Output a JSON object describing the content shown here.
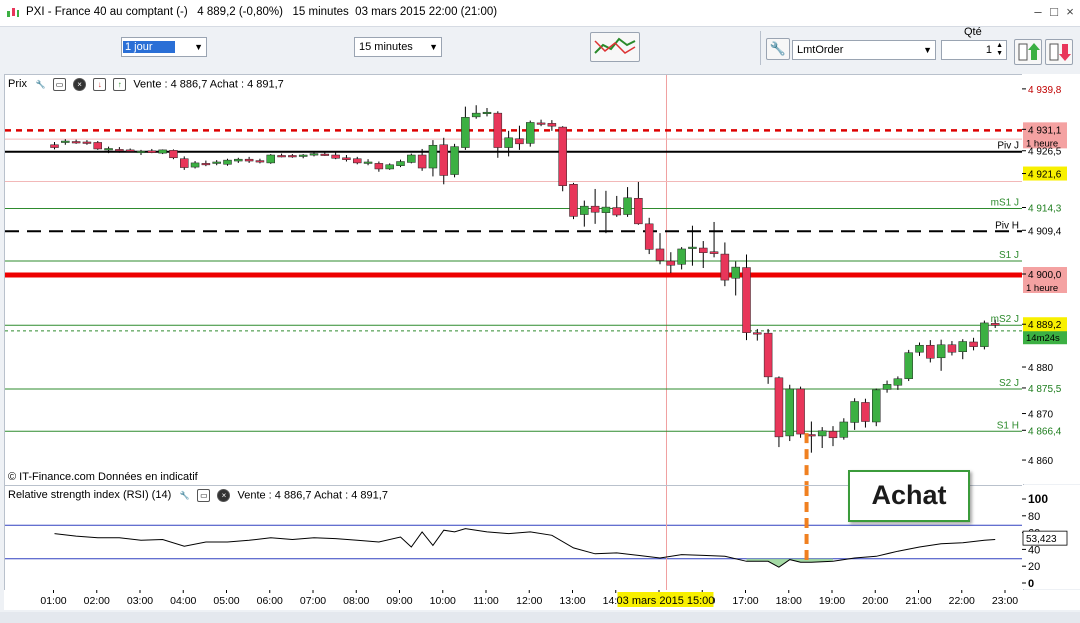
{
  "window": {
    "title": "PXI - France 40 au comptant (-)   4 889,2 (-0,80%)   15 minutes  03 mars 2015 22:00 (21:00)"
  },
  "toolbar": {
    "period_value": "1 jour",
    "interval_value": "15 minutes",
    "order_type_value": "LmtOrder",
    "qty_label": "Qté",
    "qty_value": "1"
  },
  "price_panel": {
    "label": "Prix",
    "quote": "Vente : 4 886,7 Achat : 4 891,7",
    "source": "© IT-Finance.com  Données en indicatif"
  },
  "rsi_panel": {
    "label": "Relative strength index (RSI) (14)",
    "quote": "Vente : 4 886,7 Achat : 4 891,7",
    "last_value": "53,423"
  },
  "annotation": {
    "label": "Achat"
  },
  "level_labels": [
    {
      "text": "Piv J",
      "value": 4926.5
    },
    {
      "text": "mS1 J",
      "value": 4914.3
    },
    {
      "text": "Piv H",
      "value": 4909.4
    },
    {
      "text": "S1 J",
      "value": 4903.0
    },
    {
      "text": "mS2 J",
      "value": 4889.2
    },
    {
      "text": "S2 J",
      "value": 4875.5
    },
    {
      "text": "S1 H",
      "value": 4866.4
    }
  ],
  "price_tags": [
    {
      "text": "4 939,8",
      "value": 4939.8,
      "style": "red-text"
    },
    {
      "text": "4 931,1",
      "sub": "1 heure",
      "value": 4931.1,
      "style": "red-box"
    },
    {
      "text": "4 926,5",
      "value": 4926.5,
      "style": "plain"
    },
    {
      "text": "4 921,6",
      "value": 4921.6,
      "style": "yellow-box"
    },
    {
      "text": "4 914,3",
      "value": 4914.3,
      "style": "green-text"
    },
    {
      "text": "4 909,4",
      "value": 4909.4,
      "style": "plain"
    },
    {
      "text": "4 900,0",
      "sub": "1 heure",
      "value": 4900.0,
      "style": "red-box"
    },
    {
      "text": "4 889,2",
      "sub": "14m24s",
      "value": 4889.2,
      "style": "yellow-green-box"
    },
    {
      "text": "4 880",
      "value": 4880,
      "style": "tick"
    },
    {
      "text": "4 875,5",
      "value": 4875.5,
      "style": "green-text"
    },
    {
      "text": "4 870",
      "value": 4870,
      "style": "tick"
    },
    {
      "text": "4 866,4",
      "value": 4866.4,
      "style": "green-text"
    },
    {
      "text": "4 860",
      "value": 4860,
      "style": "tick"
    }
  ],
  "rsi_ticks": [
    "100",
    "80",
    "60",
    "40",
    "20",
    "0"
  ],
  "time_ticks": [
    "01:00",
    "02:00",
    "03:00",
    "04:00",
    "05:00",
    "06:00",
    "07:00",
    "08:00",
    "09:00",
    "10:00",
    "11:00",
    "12:00",
    "13:00",
    "14:00",
    "15:00",
    "16:00",
    "17:00",
    "18:00",
    "19:00",
    "20:00",
    "21:00",
    "22:00",
    "23:00"
  ],
  "cursor_label": "03 mars 2015 15:00",
  "chart_data": {
    "type": "candlestick",
    "title": "PXI - France 40 au comptant (-)",
    "interval": "15 minutes",
    "ylim": [
      4857,
      4943
    ],
    "horizontal_lines": [
      {
        "value": 4931.1,
        "color": "#dd0000",
        "style": "dashed"
      },
      {
        "value": 4926.5,
        "color": "#000000",
        "style": "solid"
      },
      {
        "value": 4914.3,
        "color": "#2e8b2e",
        "style": "solid"
      },
      {
        "value": 4909.4,
        "color": "#000000",
        "style": "dashed"
      },
      {
        "value": 4903.0,
        "color": "#2e8b2e",
        "style": "solid"
      },
      {
        "value": 4900.0,
        "color": "#ee0000",
        "style": "thick"
      },
      {
        "value": 4889.2,
        "color": "#2e8b2e",
        "style": "solid"
      },
      {
        "value": 4875.5,
        "color": "#2e8b2e",
        "style": "solid"
      },
      {
        "value": 4866.4,
        "color": "#2e8b2e",
        "style": "solid"
      }
    ],
    "colors": {
      "up": "#3cb043",
      "down": "#e8365a",
      "wick": "#000000"
    },
    "candles": [
      {
        "t": 0.0,
        "o": 4928.0,
        "h": 4928.6,
        "l": 4927.0,
        "c": 4927.4
      },
      {
        "t": 0.25,
        "o": 4928.5,
        "h": 4929.2,
        "l": 4928.0,
        "c": 4928.8
      },
      {
        "t": 0.5,
        "o": 4928.7,
        "h": 4929.1,
        "l": 4928.2,
        "c": 4928.5
      },
      {
        "t": 0.75,
        "o": 4928.6,
        "h": 4929.0,
        "l": 4928.0,
        "c": 4928.3
      },
      {
        "t": 1.0,
        "o": 4928.5,
        "h": 4928.8,
        "l": 4926.9,
        "c": 4927.1
      },
      {
        "t": 1.25,
        "o": 4927.0,
        "h": 4927.6,
        "l": 4926.2,
        "c": 4927.2
      },
      {
        "t": 1.5,
        "o": 4927.0,
        "h": 4927.5,
        "l": 4926.3,
        "c": 4926.9
      },
      {
        "t": 1.75,
        "o": 4926.9,
        "h": 4927.2,
        "l": 4926.4,
        "c": 4926.6
      },
      {
        "t": 2.0,
        "o": 4926.5,
        "h": 4926.9,
        "l": 4925.8,
        "c": 4926.6
      },
      {
        "t": 2.25,
        "o": 4926.7,
        "h": 4927.1,
        "l": 4926.2,
        "c": 4926.3
      },
      {
        "t": 2.5,
        "o": 4926.2,
        "h": 4927.0,
        "l": 4926.0,
        "c": 4926.9
      },
      {
        "t": 2.75,
        "o": 4926.8,
        "h": 4927.0,
        "l": 4924.9,
        "c": 4925.2
      },
      {
        "t": 3.0,
        "o": 4925.0,
        "h": 4925.5,
        "l": 4922.6,
        "c": 4923.1
      },
      {
        "t": 3.25,
        "o": 4923.2,
        "h": 4924.5,
        "l": 4922.9,
        "c": 4924.1
      },
      {
        "t": 3.5,
        "o": 4924.0,
        "h": 4924.6,
        "l": 4923.4,
        "c": 4923.9
      },
      {
        "t": 3.75,
        "o": 4924.0,
        "h": 4924.7,
        "l": 4923.6,
        "c": 4924.3
      },
      {
        "t": 4.0,
        "o": 4923.8,
        "h": 4925.0,
        "l": 4923.5,
        "c": 4924.7
      },
      {
        "t": 4.25,
        "o": 4924.5,
        "h": 4925.2,
        "l": 4924.1,
        "c": 4924.9
      },
      {
        "t": 4.5,
        "o": 4924.9,
        "h": 4925.4,
        "l": 4924.1,
        "c": 4924.5
      },
      {
        "t": 4.75,
        "o": 4924.6,
        "h": 4925.0,
        "l": 4924.0,
        "c": 4924.4
      },
      {
        "t": 5.0,
        "o": 4924.1,
        "h": 4926.0,
        "l": 4923.9,
        "c": 4925.8
      },
      {
        "t": 5.25,
        "o": 4925.7,
        "h": 4926.1,
        "l": 4925.3,
        "c": 4925.6
      },
      {
        "t": 5.5,
        "o": 4925.7,
        "h": 4926.0,
        "l": 4925.2,
        "c": 4925.5
      },
      {
        "t": 5.75,
        "o": 4925.5,
        "h": 4926.0,
        "l": 4925.1,
        "c": 4925.8
      },
      {
        "t": 6.0,
        "o": 4925.8,
        "h": 4926.4,
        "l": 4925.5,
        "c": 4926.1
      },
      {
        "t": 6.25,
        "o": 4926.0,
        "h": 4926.4,
        "l": 4925.6,
        "c": 4925.8
      },
      {
        "t": 6.5,
        "o": 4925.8,
        "h": 4926.5,
        "l": 4924.9,
        "c": 4925.1
      },
      {
        "t": 6.75,
        "o": 4925.2,
        "h": 4925.8,
        "l": 4924.4,
        "c": 4924.8
      },
      {
        "t": 7.0,
        "o": 4925.0,
        "h": 4925.4,
        "l": 4923.8,
        "c": 4924.1
      },
      {
        "t": 7.25,
        "o": 4924.2,
        "h": 4924.9,
        "l": 4923.6,
        "c": 4924.3
      },
      {
        "t": 7.5,
        "o": 4924.0,
        "h": 4924.4,
        "l": 4922.2,
        "c": 4922.8
      },
      {
        "t": 7.75,
        "o": 4922.8,
        "h": 4924.0,
        "l": 4922.6,
        "c": 4923.7
      },
      {
        "t": 8.0,
        "o": 4923.5,
        "h": 4924.8,
        "l": 4923.2,
        "c": 4924.4
      },
      {
        "t": 8.25,
        "o": 4924.2,
        "h": 4926.1,
        "l": 4924.0,
        "c": 4925.8
      },
      {
        "t": 8.5,
        "o": 4925.8,
        "h": 4927.1,
        "l": 4922.4,
        "c": 4923.0
      },
      {
        "t": 8.75,
        "o": 4923.0,
        "h": 4929.0,
        "l": 4921.2,
        "c": 4927.9
      },
      {
        "t": 9.0,
        "o": 4928.0,
        "h": 4929.5,
        "l": 4919.5,
        "c": 4921.4
      },
      {
        "t": 9.25,
        "o": 4921.6,
        "h": 4928.2,
        "l": 4921.0,
        "c": 4927.6
      },
      {
        "t": 9.5,
        "o": 4927.4,
        "h": 4936.2,
        "l": 4926.9,
        "c": 4933.9
      },
      {
        "t": 9.75,
        "o": 4934.0,
        "h": 4936.5,
        "l": 4933.6,
        "c": 4934.8
      },
      {
        "t": 10.0,
        "o": 4934.8,
        "h": 4935.9,
        "l": 4934.1,
        "c": 4935.0
      },
      {
        "t": 10.25,
        "o": 4934.8,
        "h": 4935.2,
        "l": 4925.2,
        "c": 4927.4
      },
      {
        "t": 10.5,
        "o": 4927.4,
        "h": 4931.0,
        "l": 4925.5,
        "c": 4929.5
      },
      {
        "t": 10.75,
        "o": 4929.3,
        "h": 4932.1,
        "l": 4926.9,
        "c": 4928.2
      },
      {
        "t": 11.0,
        "o": 4928.3,
        "h": 4933.2,
        "l": 4927.6,
        "c": 4932.8
      },
      {
        "t": 11.25,
        "o": 4932.7,
        "h": 4933.4,
        "l": 4932.0,
        "c": 4932.6
      },
      {
        "t": 11.5,
        "o": 4932.6,
        "h": 4933.3,
        "l": 4931.0,
        "c": 4932.0
      },
      {
        "t": 11.75,
        "o": 4931.8,
        "h": 4932.0,
        "l": 4918.0,
        "c": 4919.2
      },
      {
        "t": 12.0,
        "o": 4919.5,
        "h": 4919.8,
        "l": 4912.0,
        "c": 4912.6
      },
      {
        "t": 12.25,
        "o": 4913.0,
        "h": 4916.0,
        "l": 4910.4,
        "c": 4914.8
      },
      {
        "t": 12.5,
        "o": 4914.8,
        "h": 4918.5,
        "l": 4911.0,
        "c": 4913.5
      },
      {
        "t": 12.75,
        "o": 4913.4,
        "h": 4918.1,
        "l": 4909.0,
        "c": 4914.6
      },
      {
        "t": 13.0,
        "o": 4914.5,
        "h": 4917.0,
        "l": 4912.5,
        "c": 4912.9
      },
      {
        "t": 13.25,
        "o": 4913.0,
        "h": 4918.9,
        "l": 4912.5,
        "c": 4916.6
      },
      {
        "t": 13.5,
        "o": 4916.5,
        "h": 4920.0,
        "l": 4910.8,
        "c": 4911.0
      },
      {
        "t": 13.75,
        "o": 4911.0,
        "h": 4912.3,
        "l": 4904.5,
        "c": 4905.5
      },
      {
        "t": 14.0,
        "o": 4905.6,
        "h": 4909.0,
        "l": 4902.3,
        "c": 4903.1
      },
      {
        "t": 14.25,
        "o": 4903.0,
        "h": 4904.9,
        "l": 4900.4,
        "c": 4902.1
      },
      {
        "t": 14.5,
        "o": 4902.3,
        "h": 4906.0,
        "l": 4901.2,
        "c": 4905.6
      },
      {
        "t": 14.75,
        "o": 4905.7,
        "h": 4910.6,
        "l": 4902.0,
        "c": 4906.0
      },
      {
        "t": 15.0,
        "o": 4905.8,
        "h": 4907.3,
        "l": 4901.5,
        "c": 4904.8
      },
      {
        "t": 15.25,
        "o": 4905.0,
        "h": 4911.4,
        "l": 4903.8,
        "c": 4904.6
      },
      {
        "t": 15.5,
        "o": 4904.5,
        "h": 4907.0,
        "l": 4897.6,
        "c": 4898.9
      },
      {
        "t": 15.75,
        "o": 4899.3,
        "h": 4902.9,
        "l": 4895.6,
        "c": 4901.7
      },
      {
        "t": 16.0,
        "o": 4901.6,
        "h": 4904.4,
        "l": 4886.0,
        "c": 4887.6
      },
      {
        "t": 16.25,
        "o": 4887.6,
        "h": 4888.4,
        "l": 4885.9,
        "c": 4887.3
      },
      {
        "t": 16.5,
        "o": 4887.5,
        "h": 4888.4,
        "l": 4876.6,
        "c": 4878.1
      },
      {
        "t": 16.75,
        "o": 4877.9,
        "h": 4878.2,
        "l": 4863.0,
        "c": 4865.2
      },
      {
        "t": 17.0,
        "o": 4865.4,
        "h": 4876.4,
        "l": 4864.3,
        "c": 4875.5
      },
      {
        "t": 17.25,
        "o": 4875.5,
        "h": 4876.0,
        "l": 4865.0,
        "c": 4865.8
      },
      {
        "t": 17.5,
        "o": 4865.7,
        "h": 4868.5,
        "l": 4861.8,
        "c": 4865.6
      },
      {
        "t": 17.75,
        "o": 4865.4,
        "h": 4867.3,
        "l": 4862.8,
        "c": 4866.5
      },
      {
        "t": 18.0,
        "o": 4866.4,
        "h": 4867.5,
        "l": 4863.2,
        "c": 4865.0
      },
      {
        "t": 18.25,
        "o": 4865.1,
        "h": 4869.2,
        "l": 4864.6,
        "c": 4868.4
      },
      {
        "t": 18.5,
        "o": 4868.3,
        "h": 4873.5,
        "l": 4866.7,
        "c": 4872.8
      },
      {
        "t": 18.75,
        "o": 4872.6,
        "h": 4873.4,
        "l": 4867.2,
        "c": 4868.5
      },
      {
        "t": 19.0,
        "o": 4868.4,
        "h": 4875.6,
        "l": 4867.5,
        "c": 4875.3
      },
      {
        "t": 19.25,
        "o": 4875.4,
        "h": 4877.3,
        "l": 4874.7,
        "c": 4876.5
      },
      {
        "t": 19.5,
        "o": 4876.3,
        "h": 4878.2,
        "l": 4875.3,
        "c": 4877.7
      },
      {
        "t": 19.75,
        "o": 4877.7,
        "h": 4883.9,
        "l": 4877.2,
        "c": 4883.3
      },
      {
        "t": 20.0,
        "o": 4883.4,
        "h": 4885.5,
        "l": 4882.6,
        "c": 4884.9
      },
      {
        "t": 20.25,
        "o": 4884.9,
        "h": 4886.0,
        "l": 4881.2,
        "c": 4882.1
      },
      {
        "t": 20.5,
        "o": 4882.2,
        "h": 4886.1,
        "l": 4879.4,
        "c": 4885.0
      },
      {
        "t": 20.75,
        "o": 4885.0,
        "h": 4885.8,
        "l": 4882.7,
        "c": 4883.4
      },
      {
        "t": 21.0,
        "o": 4883.5,
        "h": 4886.2,
        "l": 4881.9,
        "c": 4885.7
      },
      {
        "t": 21.25,
        "o": 4885.6,
        "h": 4886.5,
        "l": 4883.8,
        "c": 4884.6
      },
      {
        "t": 21.5,
        "o": 4884.6,
        "h": 4890.2,
        "l": 4884.0,
        "c": 4889.7
      },
      {
        "t": 21.75,
        "o": 4889.6,
        "h": 4890.4,
        "l": 4888.6,
        "c": 4889.2
      }
    ],
    "rsi": {
      "levels": [
        70,
        30
      ],
      "x": [
        0,
        0.5,
        1,
        1.5,
        2,
        2.5,
        3,
        3.5,
        4,
        4.5,
        5,
        5.5,
        6,
        6.5,
        7,
        7.5,
        8,
        8.25,
        8.5,
        8.75,
        9,
        9.25,
        9.5,
        10,
        10.5,
        11,
        11.5,
        12,
        12.5,
        13,
        13.5,
        14,
        14.5,
        15,
        15.5,
        16,
        16.5,
        16.75,
        17,
        17.25,
        17.5,
        18,
        18.5,
        19,
        19.5,
        20,
        20.5,
        21,
        21.5,
        21.75
      ],
      "values": [
        60,
        57,
        55,
        55,
        52,
        53,
        45,
        50,
        50,
        52,
        55,
        53,
        55,
        54,
        52,
        50,
        56,
        44,
        62,
        46,
        64,
        62,
        66,
        62,
        60,
        62,
        58,
        43,
        36,
        37,
        34,
        31,
        35,
        34,
        33,
        27,
        27,
        20,
        29,
        26,
        26,
        27,
        31,
        33,
        39,
        44,
        48,
        49,
        52,
        53
      ]
    }
  }
}
